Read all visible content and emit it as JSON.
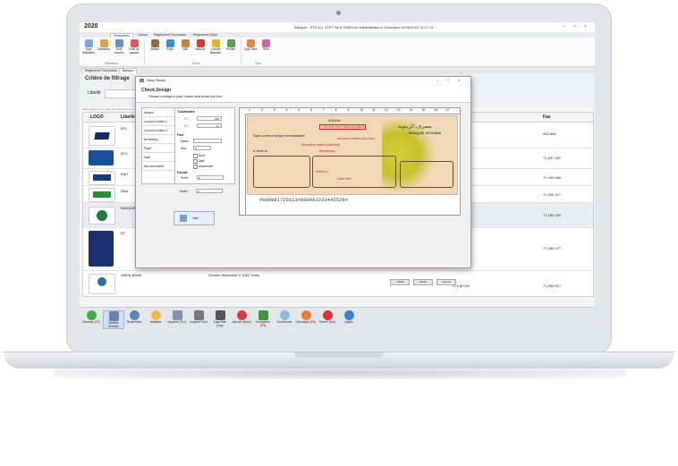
{
  "app": {
    "year": "2020",
    "title": "Banque - STE ALL SOFT MULTIMEDIA/ Administrateur/ Ouverture 26/06/2020 14:17:21"
  },
  "ribbon_tabs": [
    "Paramètres",
    "Caisse",
    "Règlement Fournisseur",
    "Règlement Client"
  ],
  "ribbon": {
    "group1": {
      "label": "Utilisateurs",
      "items": [
        "Type Utilisateur",
        "Utilisateur",
        "Droit d'accès",
        "Droit de passes"
      ]
    },
    "group2": {
      "label": "Divers",
      "items": [
        "Station",
        "Pays",
        "Ville",
        "Banque",
        "Compte Bancaire",
        "Préfixe"
      ]
    },
    "group3": {
      "label": "Tiers",
      "items": [
        "Type Tiers",
        "Tiers"
      ]
    }
  },
  "doc_tabs": [
    "Règlement Fournisseur",
    "Banque"
  ],
  "filter": {
    "title": "Critère de filtrage",
    "label": "Libellé",
    "hint": "Faites glisser un en-tête de colonne ici pour grouper par cette colonne"
  },
  "grid": {
    "columns": [
      "LOGO",
      "Libellé",
      "Fax"
    ],
    "rows": [
      {
        "code": "BTL",
        "fax": "902 808",
        "logo_color": "#1a2a6c"
      },
      {
        "code": "BTS",
        "fax": "71 847 487",
        "logo_color": "#1a4f9c"
      },
      {
        "code": "BIAT",
        "fax": "71 340 680",
        "logo_color": "#173a7a"
      },
      {
        "code": "BNA",
        "fax": "71 830 117",
        "logo_color": "#2f8a3c"
      },
      {
        "code": "BANQUE",
        "fax": "71 165 000",
        "logo_color": "#1e7a3b"
      },
      {
        "code": "BT",
        "fax": "71 349 477",
        "logo_color": "#1c2f6e"
      },
      {
        "code": "AMEN BANK",
        "address": "Avenue Mohamed V 1002 Tunis",
        "tel": "71 148 000",
        "fax": "71 833 517",
        "logo_color": "#2d6fa3"
      }
    ]
  },
  "dialog": {
    "window_title": "Setup Wizard",
    "heading": "Check Design",
    "subheading": "Please configure your check and enter the text",
    "nav": [
      "Amount",
      "Amount in letters 1",
      "Amount in letters 2",
      "Beneficiary",
      "Place",
      "Date",
      "Non endorsable"
    ],
    "coordinates_label": "Coordinates",
    "x_label": "X =",
    "x_value": "146",
    "y_label": "Y =",
    "y_value": "12",
    "font_label": "Font",
    "name_label": "Name",
    "size_label": "Size",
    "size_value": "9",
    "bold": "Bold",
    "italic": "Italic",
    "underlined": "Underlined",
    "format_label": "Format",
    "prefix_label": "Prefix",
    "prefix_value": "#",
    "suffix_label": "Suffix",
    "suffix_value": "#",
    "text_button": "Text",
    "back": "< Back",
    "finish": "Finish",
    "cancel": "Cancel",
    "ruler": [
      "1",
      "2",
      "3",
      "4",
      "5",
      "6",
      "7",
      "8",
      "9",
      "10",
      "11",
      "12",
      "13",
      "14",
      "15",
      "16",
      "17"
    ],
    "check": {
      "bank_ar": "مصرف الزيتونة",
      "bank_name": "BANQUE ZITOUNA",
      "amount_tag": "#000###",
      "non_endorsable": "CHEQUE NON ENDOSSABLE",
      "pay_line": "Payez contre ce chèque non endossable",
      "amount_letters_1": "Amount in letters (1st line)",
      "amount_letters_2": "Amount in letters (2nd line)",
      "beneficiary": "Beneficiary",
      "order_label": "À l'ordre de",
      "place_label": "Edited in",
      "date_label": "Date here",
      "micr": "#000061725113#000002233445529#"
    }
  },
  "footer": [
    "Nouveau (F2)",
    "Modifier (Entrée)",
    "Rechercher",
    "Initialiser",
    "Imprimer (F11)",
    "Imprimer Tout",
    "Supprimer (sup)",
    "Annuler (Back)",
    "Enregistrer (F3)",
    "Transformer",
    "Recharger (F5)",
    "Fermer (Esc)",
    "Quitter"
  ]
}
